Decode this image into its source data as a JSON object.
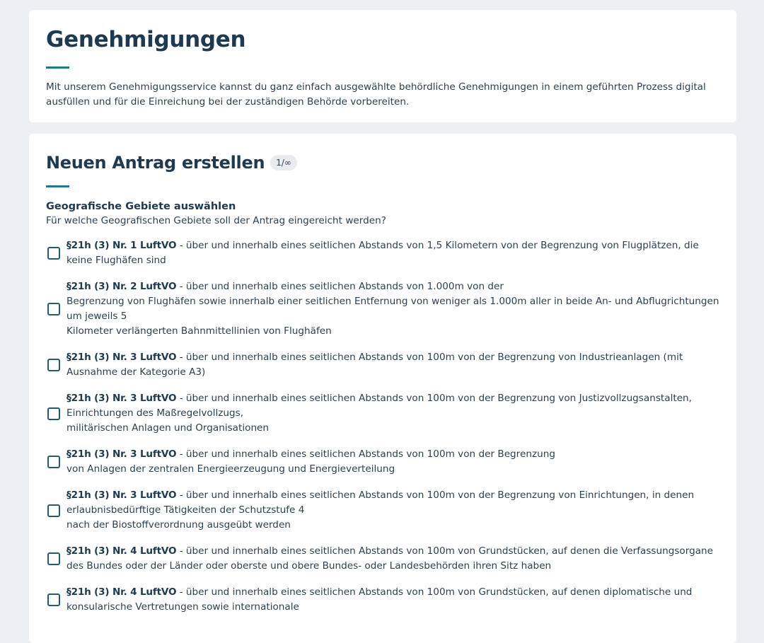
{
  "intro": {
    "title": "Genehmigungen",
    "description": "Mit unserem Genehmigungsservice kannst du ganz einfach ausgewählte behördliche Genehmigungen in einem geführten Prozess digital ausfüllen und für die Einreichung bei der zuständigen Behörde vorbereiten."
  },
  "form": {
    "title": "Neuen Antrag erstellen",
    "quota": "1/∞",
    "field_label": "Geografische Gebiete auswählen",
    "field_question": "Für welche Geografischen Gebiete soll der Antrag eingereicht werden?",
    "options": [
      {
        "law": "§21h (3) Nr. 1 LuftVO",
        "lines": [
          "- über und innerhalb eines seitlichen Abstands von 1,5 Kilometern von der Begrenzung von Flugplätzen, die keine Flughäfen sind"
        ]
      },
      {
        "law": "§21h (3) Nr. 2 LuftVO",
        "lines": [
          "- über und innerhalb eines seitlichen Abstands von 1.000m von der",
          "Begrenzung von Flughäfen sowie innerhalb einer seitlichen Entfernung von weniger als 1.000m aller in beide An- und Abflugrichtungen um jeweils 5",
          "Kilometer verlängerten Bahnmittellinien von Flughäfen"
        ]
      },
      {
        "law": "§21h (3) Nr. 3 LuftVO",
        "lines": [
          "- über und innerhalb eines seitlichen Abstands von 100m von der Begrenzung von Industrieanlagen (mit Ausnahme der Kategorie A3)"
        ]
      },
      {
        "law": "§21h (3) Nr. 3 LuftVO",
        "lines": [
          "- über und innerhalb eines seitlichen Abstands von 100m von der Begrenzung von Justizvollzugsanstalten, Einrichtungen des Maßregelvollzugs,",
          "militärischen Anlagen und Organisationen"
        ]
      },
      {
        "law": "§21h (3) Nr. 3 LuftVO",
        "lines": [
          "- über und innerhalb eines seitlichen Abstands von 100m von der Begrenzung",
          "von Anlagen der zentralen Energieerzeugung und Energieverteilung"
        ]
      },
      {
        "law": "§21h (3) Nr. 3 LuftVO",
        "lines": [
          "- über und innerhalb eines seitlichen Abstands von 100m von der Begrenzung von Einrichtungen, in denen erlaubnisbedürftige Tätigkeiten der Schutzstufe 4",
          "nach der Biostoffverordnung ausgeübt werden"
        ]
      },
      {
        "law": "§21h (3) Nr. 4 LuftVO",
        "lines": [
          "- über und innerhalb eines seitlichen Abstands von 100m von Grundstücken, auf denen die Verfassungsorgane des Bundes oder der Länder oder oberste und obere Bundes- oder Landesbehörden ihren Sitz haben"
        ]
      },
      {
        "law": "§21h (3) Nr. 4 LuftVO",
        "lines": [
          "- über und innerhalb eines seitlichen Abstands von 100m von Grundstücken, auf denen diplomatische und konsularische Vertretungen sowie internationale"
        ]
      }
    ]
  },
  "colors": {
    "background": "#ecf0f3",
    "card": "#ffffff",
    "heading": "#1d3a52",
    "accent_rule": "#1f7a8c",
    "checkbox_border": "#1f5b7a"
  }
}
